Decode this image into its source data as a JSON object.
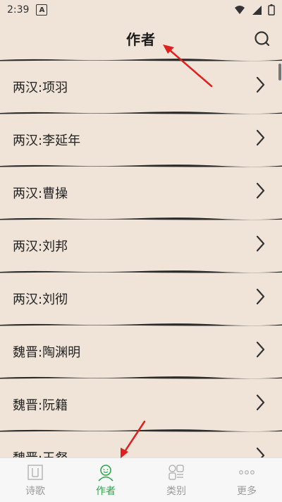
{
  "status_bar": {
    "time": "2:39",
    "notification_letter": "A"
  },
  "header": {
    "title": "作者"
  },
  "authors": [
    "两汉:项羽",
    "两汉:李延年",
    "两汉:曹操",
    "两汉:刘邦",
    "两汉:刘彻",
    "魏晋:陶渊明",
    "魏晋:阮籍",
    "魏晋:王粲"
  ],
  "bottom_nav": {
    "items": [
      {
        "label": "诗歌",
        "icon": "poetry-icon"
      },
      {
        "label": "作者",
        "icon": "author-icon",
        "active": true
      },
      {
        "label": "类别",
        "icon": "category-icon"
      },
      {
        "label": "更多",
        "icon": "more-icon"
      }
    ]
  },
  "colors": {
    "background": "#efe4d7",
    "accent": "#2ea64d",
    "annotation_arrow": "#e02020"
  }
}
